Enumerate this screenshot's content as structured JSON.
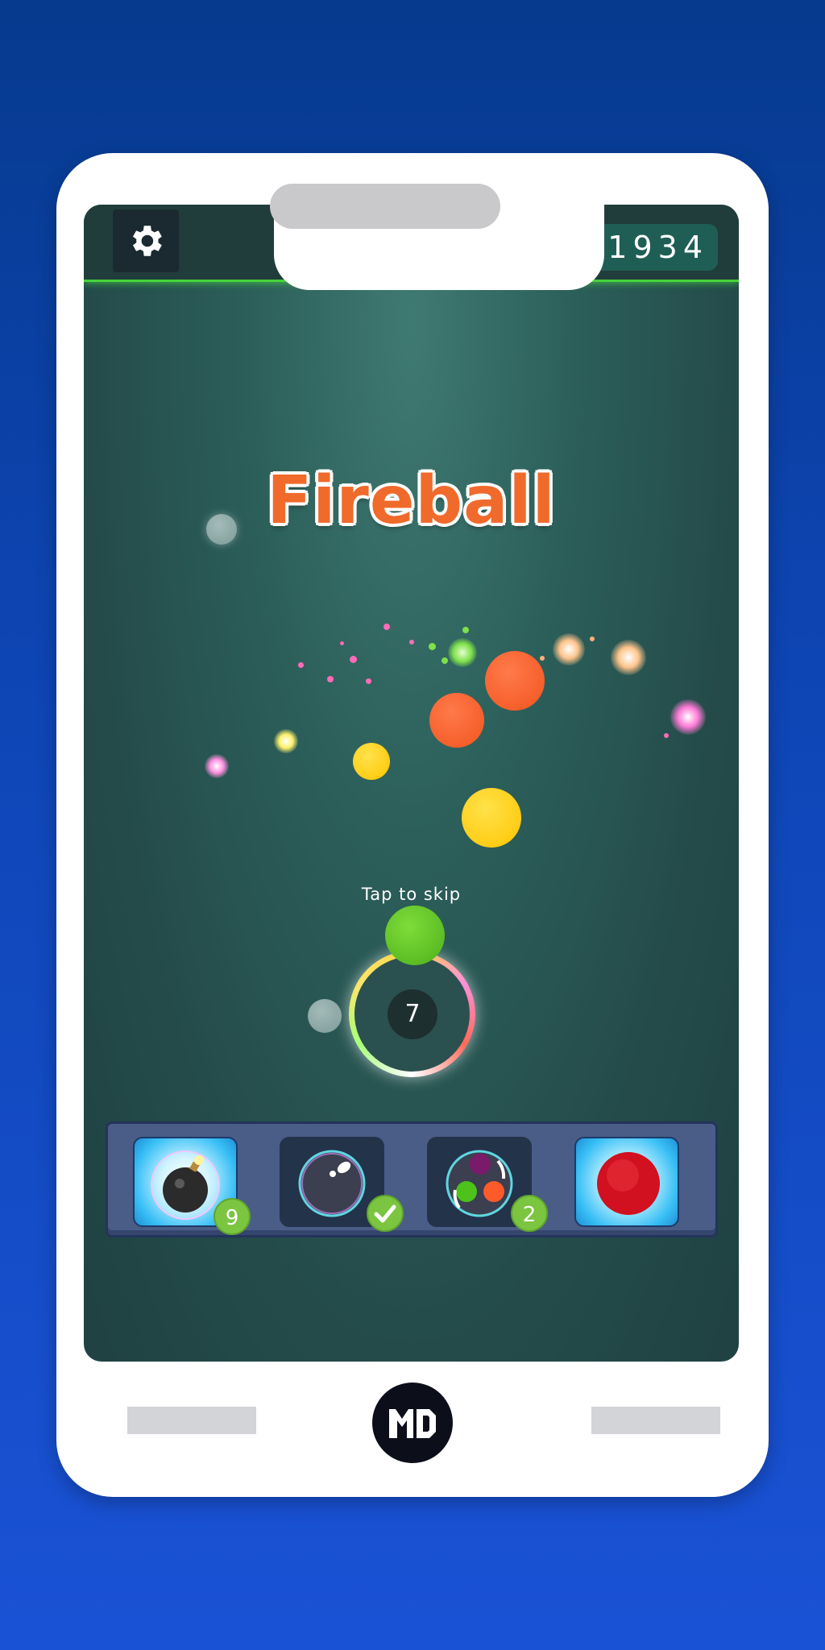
{
  "header": {
    "score": "11934",
    "settings_icon": "gear-icon",
    "progress": {
      "fill_fraction": 0.75,
      "segments": 4
    }
  },
  "game": {
    "powerup_title": "Fireball",
    "skip_hint": "Tap to skip",
    "shots_remaining": "7",
    "colors": {
      "title": "#f06a2c",
      "orange_ball": "#ff5c2e",
      "yellow_ball": "#ffd11a",
      "green_ball": "#5cc21e",
      "red_ball": "#d11020"
    }
  },
  "powerups": [
    {
      "name": "bomb",
      "icon": "bomb-icon",
      "count": "9",
      "selected": true
    },
    {
      "name": "empty-bubble",
      "icon": "bubble-icon",
      "status": "checkmark-icon",
      "selected": false
    },
    {
      "name": "color-swap",
      "icon": "color-swap-icon",
      "count": "2",
      "selected": false
    },
    {
      "name": "fireball",
      "icon": "red-ball-icon",
      "selected": true
    }
  ],
  "device": {
    "logo": "md-logo"
  }
}
